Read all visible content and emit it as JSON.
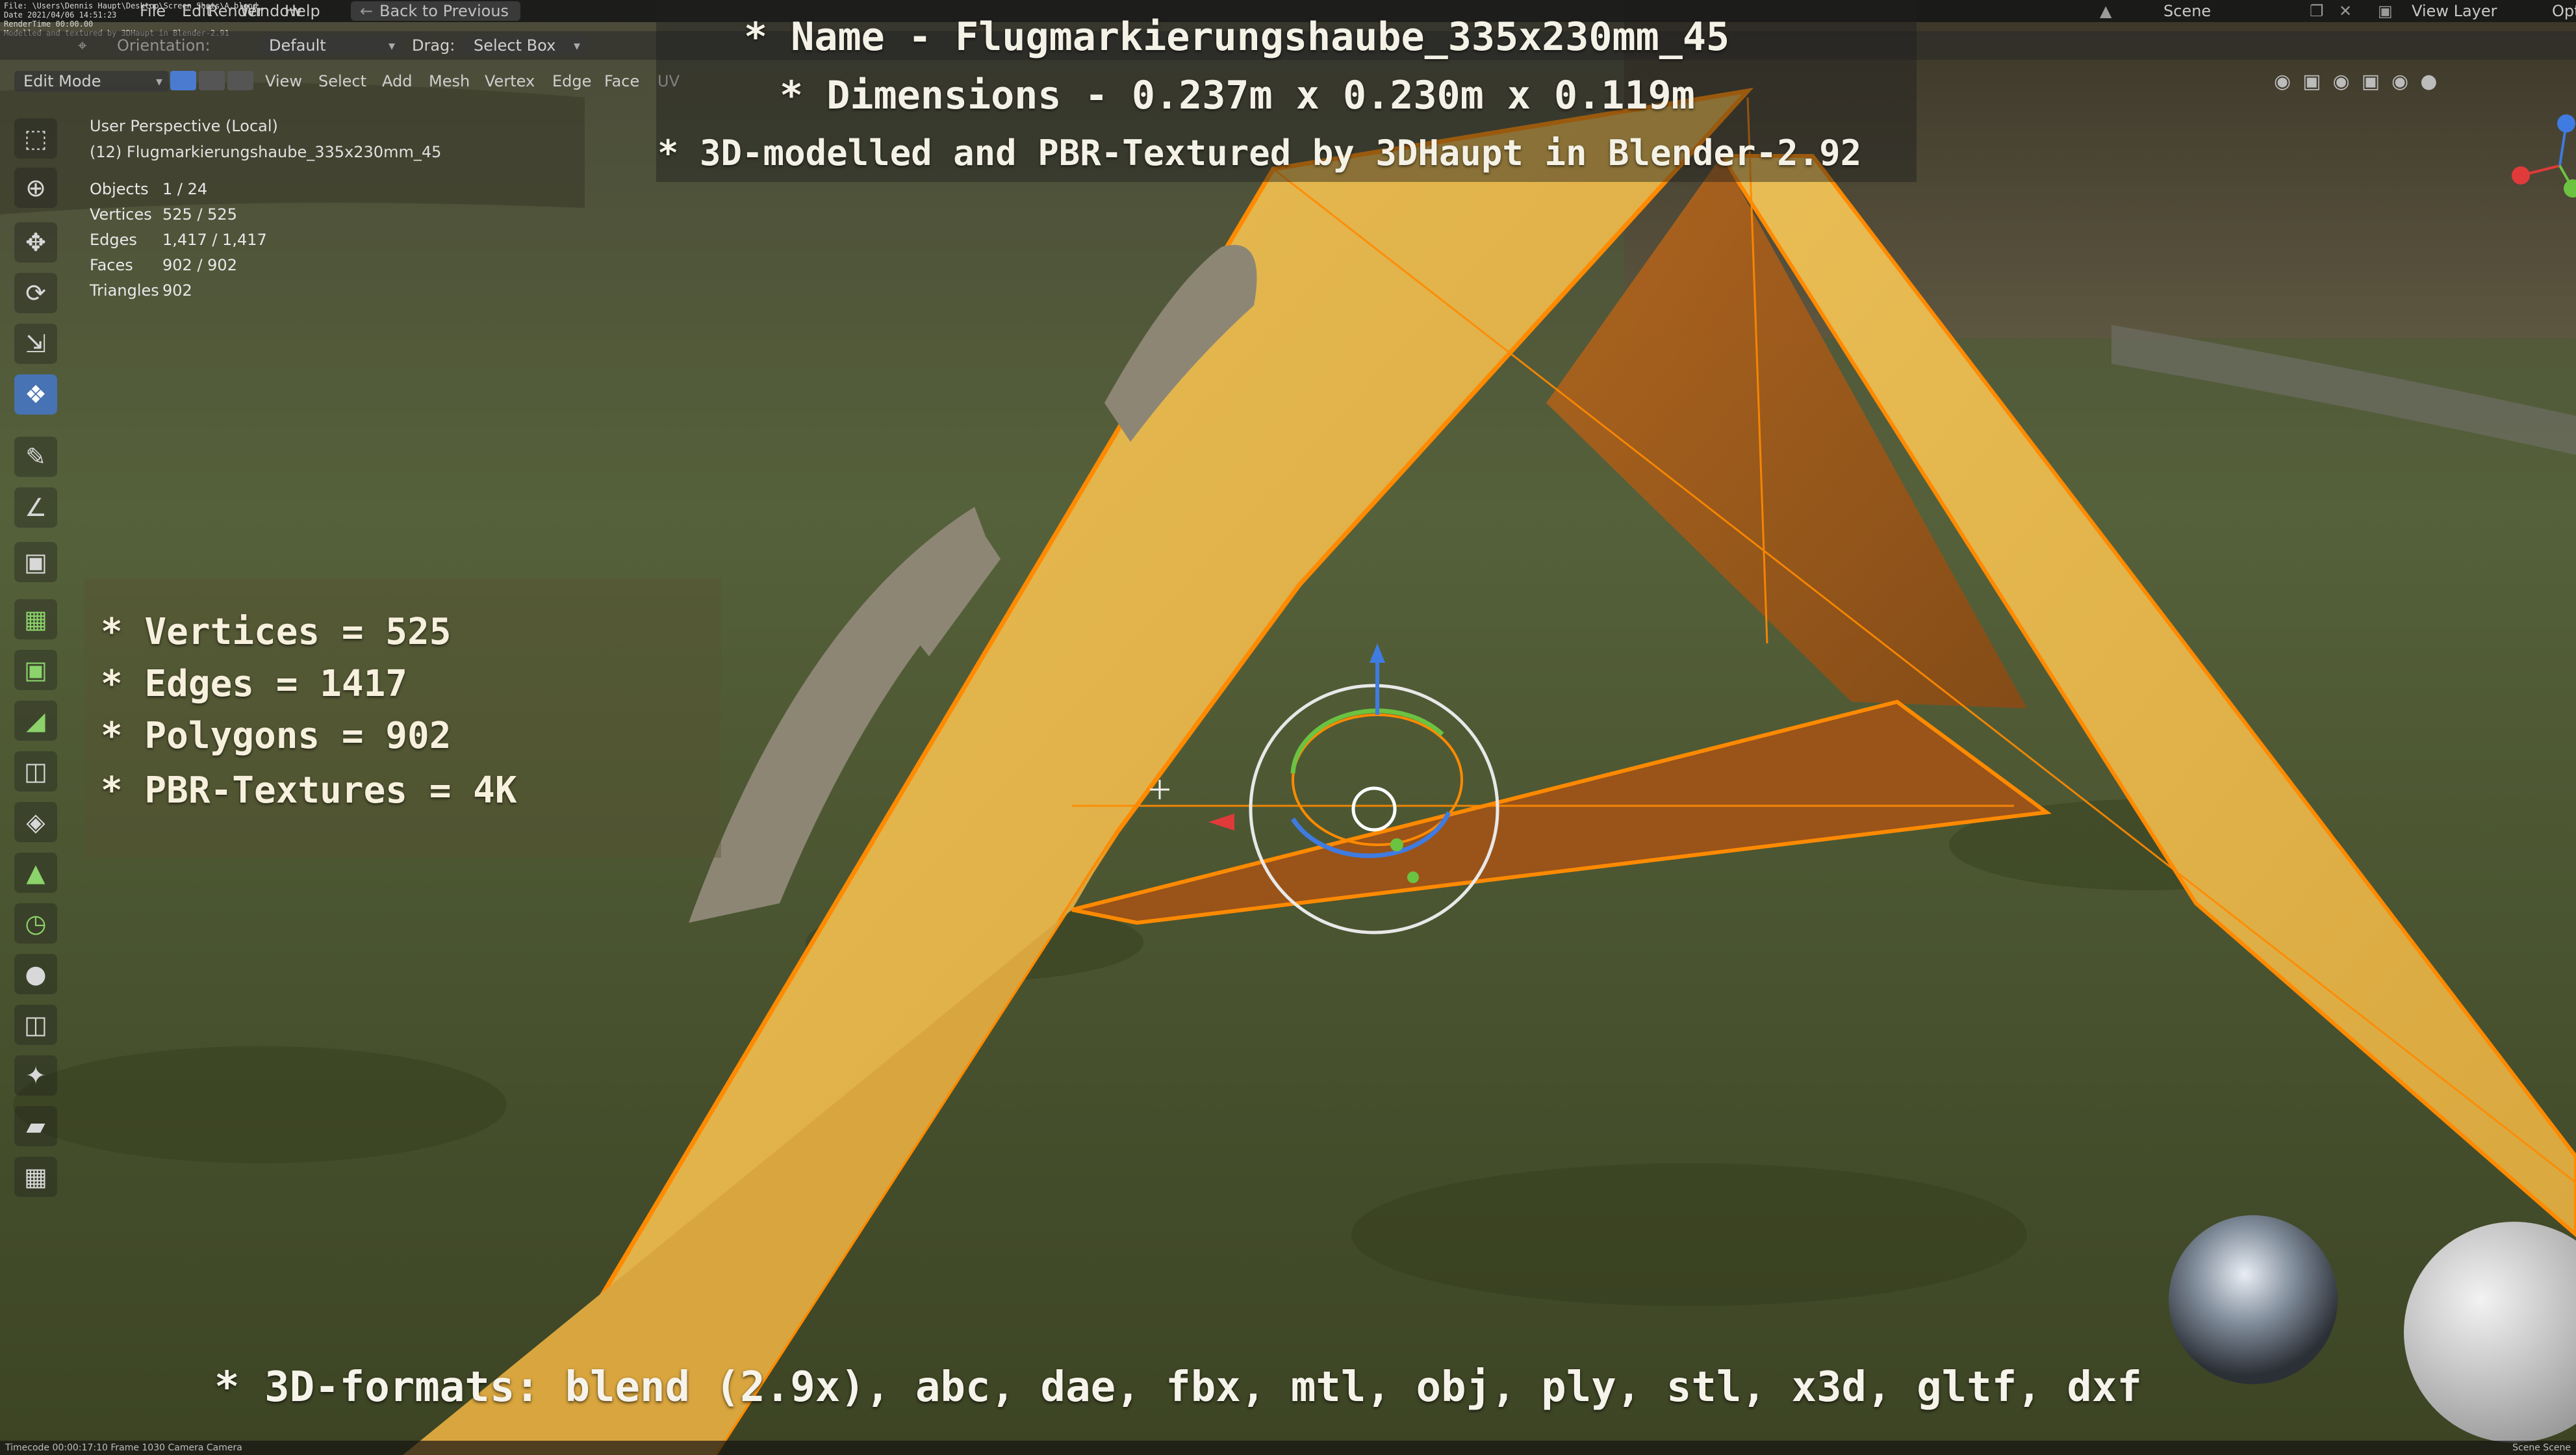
{
  "top_menu": {
    "log_lines": [
      "File: \\Users\\Dennis Haupt\\Desktop\\Screen Shots\\A.blend",
      "Date 2021/04/06 14:51:23",
      "RenderTime 00:00.00",
      "Modelled and textured by 3DHaupt in Blender-2.91"
    ],
    "items": [
      "File",
      "Edit",
      "Render",
      "Window",
      "Help"
    ],
    "back_button": "Back to Previous",
    "scene_label": "Scene",
    "view_layer_label": "View Layer",
    "opt_label": "Opt"
  },
  "header": {
    "orientation_label": "Orientation:",
    "orientation_value": "Default",
    "drag_label": "Drag:",
    "drag_value": "Select Box",
    "mode": "Edit Mode",
    "menus": [
      "View",
      "Select",
      "Add",
      "Mesh",
      "Vertex",
      "Edge",
      "Face",
      "UV"
    ]
  },
  "viewport_info": {
    "perspective": "User Perspective (Local)",
    "object": "(12) Flugmarkierungshaube_335x230mm_45",
    "stats": [
      {
        "label": "Objects",
        "value": "1 / 24"
      },
      {
        "label": "Vertices",
        "value": "525 / 525"
      },
      {
        "label": "Edges",
        "value": "1,417 / 1,417"
      },
      {
        "label": "Faces",
        "value": "902 / 902"
      },
      {
        "label": "Triangles",
        "value": "902"
      }
    ]
  },
  "overlay": {
    "name_line": "* Name - Flugmarkierungshaube_335x230mm_45",
    "dimensions_line": "* Dimensions -  0.237m x 0.230m x 0.119m",
    "credit_line": "* 3D-modelled and PBR-Textured by 3DHaupt in Blender-2.92",
    "vertices_line": "* Vertices = 525",
    "edges_line": "* Edges = 1417",
    "polygons_line": "* Polygons = 902",
    "textures_line": "* PBR-Textures = 4K",
    "formats_line": "* 3D-formats: blend (2.9x), abc, dae, fbx, mtl, obj, ply, stl, x3d, gltf, dxf"
  },
  "footer": {
    "timecode": "Timecode 00:00:17:10   Frame 1030   Camera Camera",
    "right": "Scene Scene"
  },
  "colors": {
    "board_yellow": "#e2b24a",
    "edge_orange": "#ff8a00",
    "grass": "#4e5a2f",
    "active_tool": "#4772b3"
  }
}
